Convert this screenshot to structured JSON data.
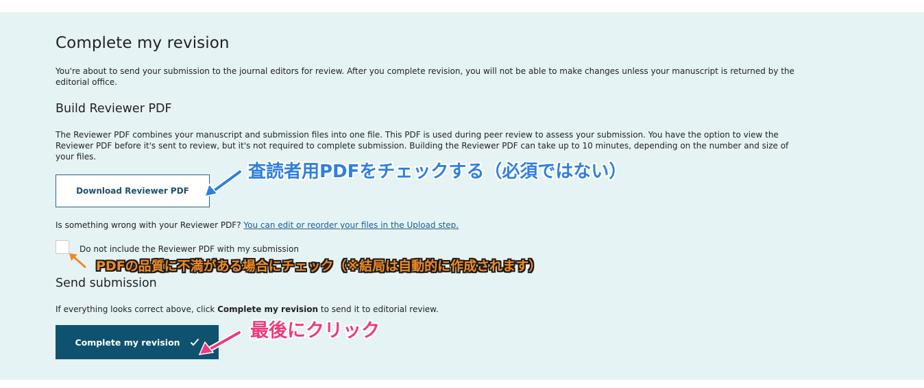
{
  "revision": {
    "title": "Complete my revision",
    "intro": "You're about to send your submission to the journal editors for review. After you complete revision, you will not be able to make changes unless your manuscript is returned by the editorial office."
  },
  "reviewer_pdf": {
    "heading": "Build Reviewer PDF",
    "description": "The Reviewer PDF combines your manuscript and submission files into one file. This PDF is used during peer review to assess your submission. You have the option to view the Reviewer PDF before it's sent to review, but it's not required to complete submission. Building the Reviewer PDF can take up to 10 minutes, depending on the number and size of your files.",
    "download_label": "Download Reviewer PDF",
    "problem_text": "Is something wrong with your Reviewer PDF? ",
    "edit_link": "You can edit or reorder your files in the Upload step.",
    "exclude_label": "Do not include the Reviewer PDF with my submission",
    "exclude_checked": false
  },
  "send": {
    "heading": "Send submission",
    "text_before": "If everything looks correct above, click ",
    "text_bold": "Complete my revision",
    "text_after": " to send it to editorial review.",
    "button_label": "Complete my revision",
    "button_icon": "check-icon"
  },
  "annotations": {
    "blue": "査読者用PDFをチェックする（必須ではない）",
    "orange": "PDFの品質に不満がある場合にチェック（※結局は自動的に作成されます）",
    "pink": "最後にクリック"
  },
  "colors": {
    "panel_bg": "#e6f3f4",
    "primary": "#0f5270",
    "link": "#1f5d8a",
    "anno_blue": "#2f7fe0",
    "anno_orange": "#f08a24",
    "anno_pink": "#ee3a7c"
  }
}
